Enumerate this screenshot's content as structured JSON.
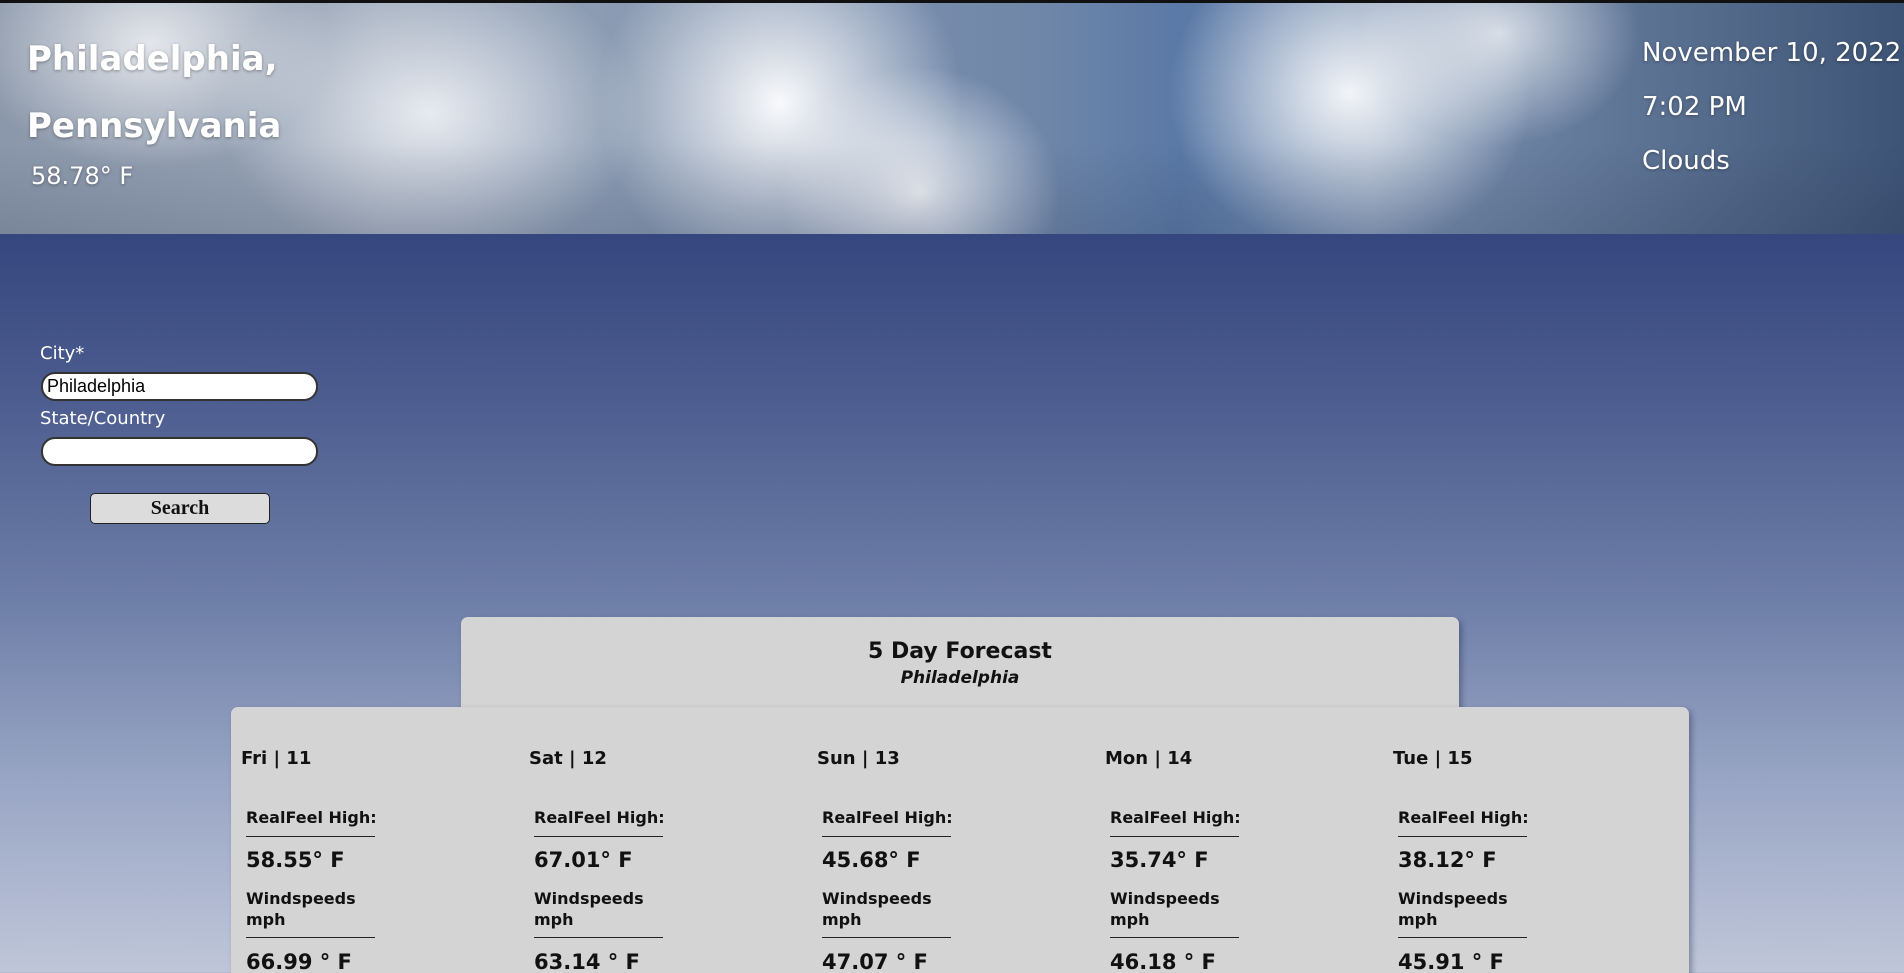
{
  "header": {
    "city_line": "Philadelphia,",
    "state_line": "Pennsylvania",
    "temperature": "58.78° F",
    "date": "November 10, 2022",
    "time": "7:02 PM",
    "condition": "Clouds"
  },
  "search": {
    "city_label": "City*",
    "city_value": "Philadelphia",
    "state_label": "State/Country",
    "state_value": "",
    "button_label": "Search"
  },
  "forecast": {
    "title": "5 Day Forecast",
    "subtitle": "Philadelphia",
    "days": [
      {
        "day": "Fri | 11",
        "realfeel_label": "RealFeel High:",
        "realfeel_value": "58.55° F",
        "wind_label": "Windspeeds mph",
        "wind_value": "66.99 ° F"
      },
      {
        "day": "Sat | 12",
        "realfeel_label": "RealFeel High:",
        "realfeel_value": "67.01° F",
        "wind_label": "Windspeeds mph",
        "wind_value": "63.14 ° F"
      },
      {
        "day": "Sun | 13",
        "realfeel_label": "RealFeel High:",
        "realfeel_value": "45.68° F",
        "wind_label": "Windspeeds mph",
        "wind_value": "47.07 ° F"
      },
      {
        "day": "Mon | 14",
        "realfeel_label": "RealFeel High:",
        "realfeel_value": "35.74° F",
        "wind_label": "Windspeeds mph",
        "wind_value": "46.18 ° F"
      },
      {
        "day": "Tue | 15",
        "realfeel_label": "RealFeel High:",
        "realfeel_value": "38.12° F",
        "wind_label": "Windspeeds mph",
        "wind_value": "45.91 ° F"
      }
    ]
  }
}
